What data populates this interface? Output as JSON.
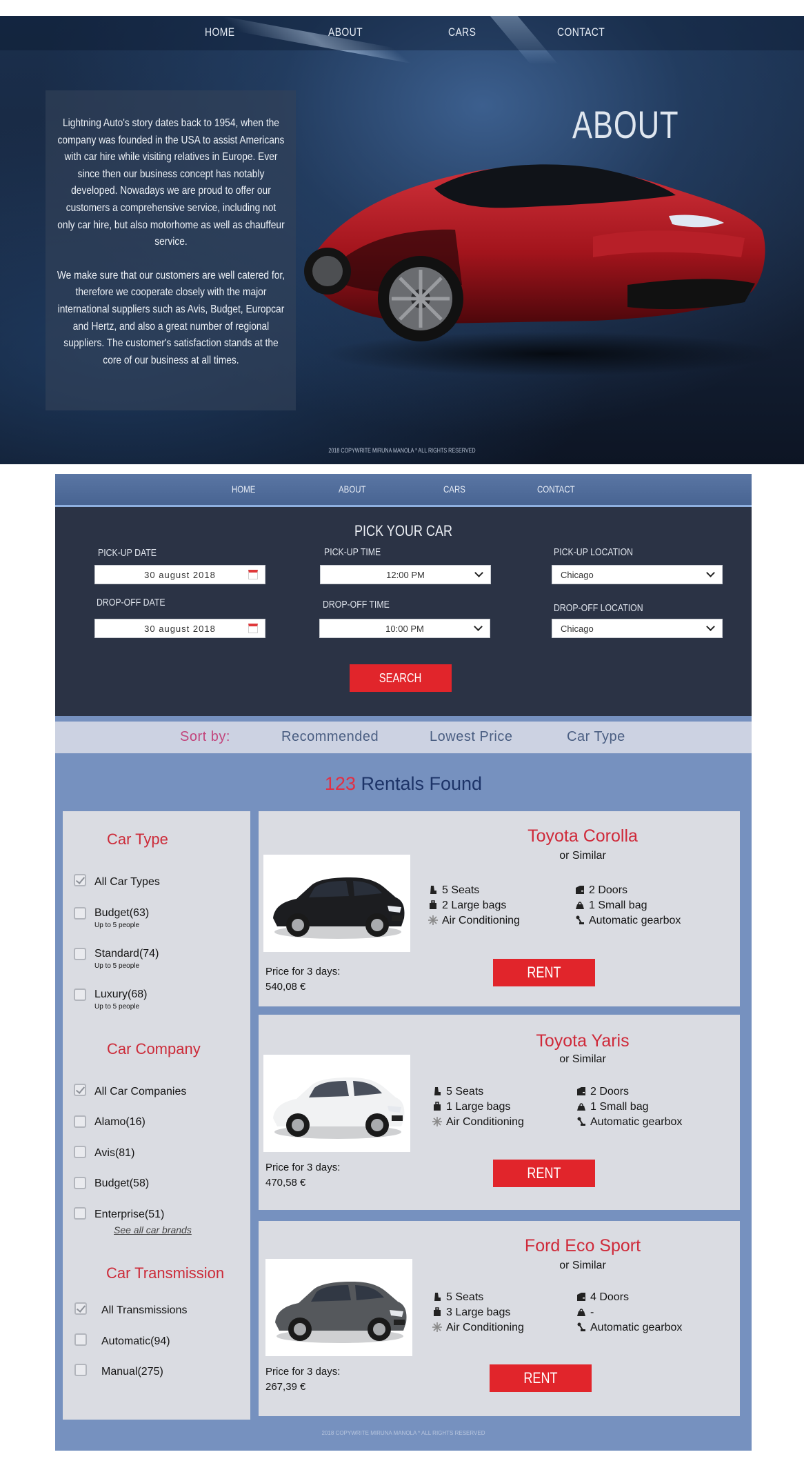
{
  "hero": {
    "nav": [
      "HOME",
      "ABOUT",
      "CARS",
      "CONTACT"
    ],
    "title": "ABOUT",
    "paragraphs": [
      "Lightning Auto's story dates back to 1954, when the company was founded in the USA to assist Americans with car hire while visiting relatives in Europe. Ever since then our business concept has notably developed. Nowadays we are proud to offer our customers a comprehensive service, including not only car hire, but also motorhome as well as chauffeur service.",
      "We make sure that our customers are well catered for, therefore we cooperate closely with the major international suppliers such as Avis, Budget, Europcar and Hertz, and also a great number of regional suppliers. The customer's satisfaction stands at the core of our business at all times."
    ],
    "copyright": "2018 COPYWRITE MIRUNA MANOLA * ALL RIGHTS RESERVED"
  },
  "rental": {
    "nav": [
      "HOME",
      "ABOUT",
      "CARS",
      "CONTACT"
    ],
    "pick_title": "PICK YOUR CAR",
    "pickup_date": {
      "label": "PICK-UP DATE",
      "value": "30  august  2018"
    },
    "dropoff_date": {
      "label": "DROP-OFF DATE",
      "value": "30  august  2018"
    },
    "pickup_time": {
      "label": "PICK-UP TIME",
      "value": "12:00  PM"
    },
    "dropoff_time": {
      "label": "DROP-OFF TIME",
      "value": "10:00  PM"
    },
    "pickup_location": {
      "label": "PICK-UP LOCATION",
      "value": "Chicago"
    },
    "dropoff_location": {
      "label": "DROP-OFF LOCATION",
      "value": "Chicago"
    },
    "search_label": "SEARCH",
    "sort": {
      "label": "Sort  by:",
      "options": [
        "Recommended",
        "Lowest  Price",
        "Car  Type"
      ]
    },
    "found": {
      "count": "123",
      "text": " Rentals Found"
    },
    "filters": {
      "car_type": {
        "title": "Car Type",
        "items": [
          {
            "label": "All Car Types",
            "sub": "",
            "checked": true
          },
          {
            "label": "Budget(63)",
            "sub": "Up to 5 people",
            "checked": false
          },
          {
            "label": "Standard(74)",
            "sub": "Up to 5 people",
            "checked": false
          },
          {
            "label": "Luxury(68)",
            "sub": "Up to 5 people",
            "checked": false
          }
        ]
      },
      "car_company": {
        "title": "Car Company",
        "items": [
          {
            "label": "All Car Companies",
            "checked": true
          },
          {
            "label": "Alamo(16)",
            "checked": false
          },
          {
            "label": "Avis(81)",
            "checked": false
          },
          {
            "label": "Budget(58)",
            "checked": false
          },
          {
            "label": "Enterprise(51)",
            "checked": false
          }
        ],
        "see_all": "See all car brands"
      },
      "transmission": {
        "title": "Car Transmission",
        "items": [
          {
            "label": "All Transmissions",
            "checked": true
          },
          {
            "label": "Automatic(94)",
            "checked": false
          },
          {
            "label": "Manual(275)",
            "checked": false
          }
        ]
      }
    },
    "cars": [
      {
        "name": "Toyota Corolla",
        "similar": "or Similar",
        "seats": "5 Seats",
        "bags": "2 Large bags",
        "ac": "Air Conditioning",
        "doors": "2 Doors",
        "small_bags": "1 Small bag",
        "gearbox": "Automatic gearbox",
        "price_label": "Price for 3 days:",
        "price": "540,08 €",
        "rent": "RENT",
        "color": "#1c1d20"
      },
      {
        "name": "Toyota Yaris",
        "similar": "or Similar",
        "seats": "5 Seats",
        "bags": "1 Large bags",
        "ac": "Air Conditioning",
        "doors": "2 Doors",
        "small_bags": "1 Small bag",
        "gearbox": "Automatic gearbox",
        "price_label": "Price for 3 days:",
        "price": "470,58 €",
        "rent": "RENT",
        "color": "#f1f2f3"
      },
      {
        "name": "Ford Eco Sport",
        "similar": "or Similar",
        "seats": "5 Seats",
        "bags": "3 Large bags",
        "ac": "Air Conditioning",
        "doors": "4 Doors",
        "small_bags": "-",
        "gearbox": "Automatic gearbox",
        "price_label": "Price for 3 days:",
        "price": "267,39 €",
        "rent": "RENT",
        "color": "#55585c"
      }
    ],
    "copyright": "2018 COPYWRITE MIRUNA MANOLA * ALL RIGHTS RESERVED"
  }
}
